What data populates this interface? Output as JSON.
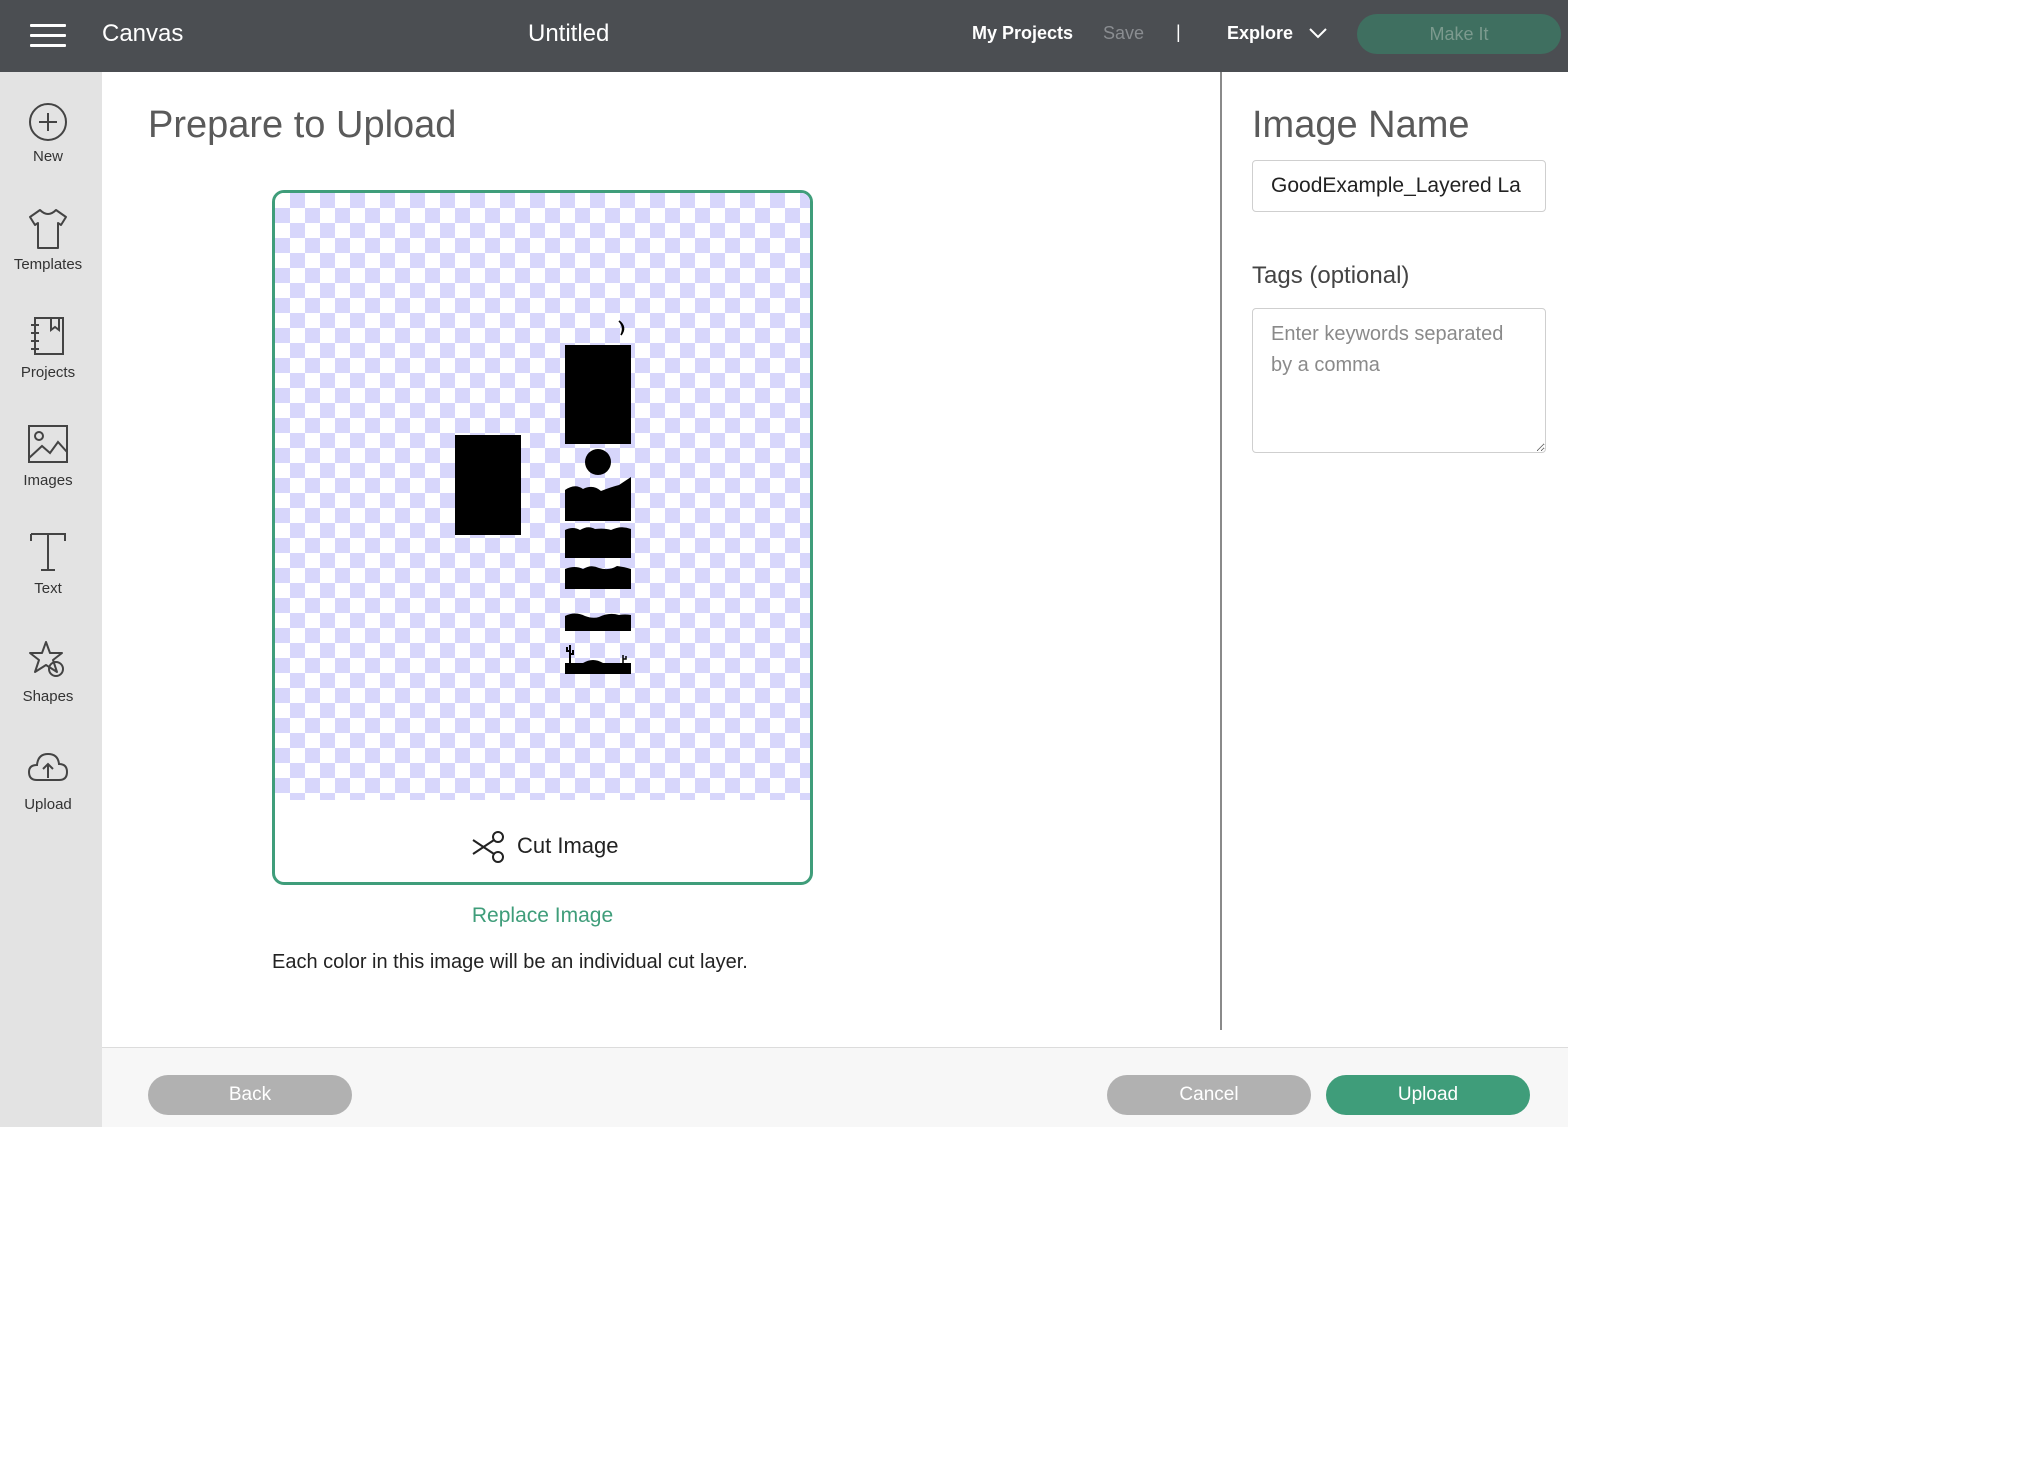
{
  "topbar": {
    "app_title": "Canvas",
    "doc_title": "Untitled",
    "my_projects": "My Projects",
    "save": "Save",
    "separator": "|",
    "explore": "Explore",
    "make_it": "Make It"
  },
  "sidebar": {
    "items": [
      {
        "label": "New",
        "icon": "plus-circle-icon"
      },
      {
        "label": "Templates",
        "icon": "tshirt-icon"
      },
      {
        "label": "Projects",
        "icon": "notebook-icon"
      },
      {
        "label": "Images",
        "icon": "image-icon"
      },
      {
        "label": "Text",
        "icon": "text-t-icon"
      },
      {
        "label": "Shapes",
        "icon": "shapes-icon"
      },
      {
        "label": "Upload",
        "icon": "cloud-upload-icon"
      }
    ]
  },
  "main": {
    "title": "Prepare to Upload",
    "cut_image": "Cut Image",
    "replace_image": "Replace Image",
    "hint": "Each color in this image will be an individual cut layer."
  },
  "right_panel": {
    "image_name_title": "Image Name",
    "image_name_value": "GoodExample_Layered La",
    "tags_label": "Tags (optional)",
    "tags_placeholder": "Enter keywords separated by a comma"
  },
  "footer": {
    "back": "Back",
    "cancel": "Cancel",
    "upload": "Upload"
  },
  "colors": {
    "topbar": "#4b4e52",
    "accent_green": "#3f9d7a",
    "checker": "#d7d6fb",
    "disabled_button": "#b1b1b1"
  }
}
